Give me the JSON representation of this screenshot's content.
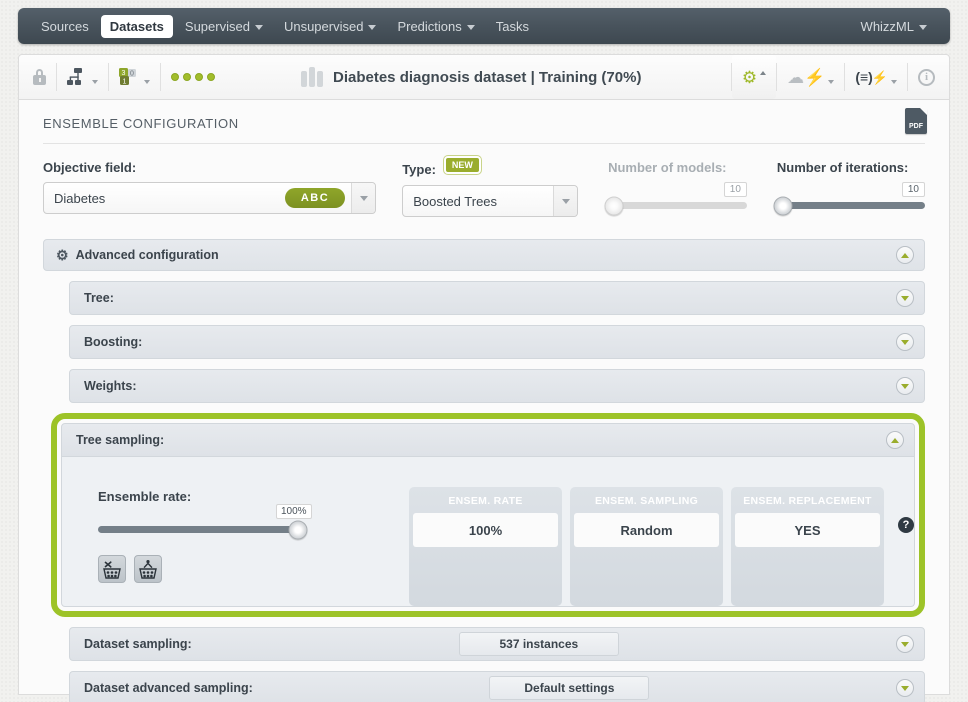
{
  "nav": {
    "items": [
      {
        "label": "Sources",
        "caret": false,
        "active": false
      },
      {
        "label": "Datasets",
        "caret": false,
        "active": true
      },
      {
        "label": "Supervised",
        "caret": true,
        "active": false
      },
      {
        "label": "Unsupervised",
        "caret": true,
        "active": false
      },
      {
        "label": "Predictions",
        "caret": true,
        "active": false
      },
      {
        "label": "Tasks",
        "caret": false,
        "active": false
      }
    ],
    "right": {
      "label": "WhizzML",
      "caret": true
    }
  },
  "toolbar": {
    "lock_icon": "lock-icon",
    "tree_icon": "model-tree-icon",
    "numeric_icon": "field-types-icon",
    "status_dots": 4,
    "dataset_icon": "dataset-bars-icon",
    "title": "Diabetes diagnosis dataset | Training (70%)",
    "right_icons": [
      {
        "name": "configure-gear-icon",
        "glyph": "⚙",
        "state": "active"
      },
      {
        "name": "flash-cloud-icon",
        "glyph": "⚡",
        "state": "disabled"
      },
      {
        "name": "batch-script-icon",
        "glyph": "(≡)",
        "state": "active"
      },
      {
        "name": "info-icon",
        "glyph": "i",
        "state": "disabled"
      }
    ]
  },
  "panel": {
    "title": "ENSEMBLE CONFIGURATION",
    "pdf_label": "PDF"
  },
  "form": {
    "objective": {
      "label": "Objective field:",
      "value": "Diabetes",
      "badge": "ABC"
    },
    "type": {
      "label": "Type:",
      "badge": "NEW",
      "value": "Boosted Trees"
    },
    "number_of_models": {
      "label": "Number of models:",
      "value": "10",
      "percent": 4,
      "disabled": true
    },
    "number_of_iterations": {
      "label": "Number of iterations:",
      "value": "10",
      "percent": 4,
      "disabled": false
    }
  },
  "advanced": {
    "label": "Advanced configuration",
    "expanded": true,
    "sections": [
      {
        "label": "Tree:",
        "expanded": false,
        "pill": ""
      },
      {
        "label": "Boosting:",
        "expanded": false,
        "pill": ""
      },
      {
        "label": "Weights:",
        "expanded": false,
        "pill": ""
      }
    ],
    "bottom_sections": [
      {
        "label": "Dataset sampling:",
        "expanded": false,
        "pill": "537 instances"
      },
      {
        "label": "Dataset advanced sampling:",
        "expanded": false,
        "pill": "Default settings"
      }
    ]
  },
  "tree_sampling": {
    "label": "Tree sampling:",
    "expanded": true,
    "highlight_color": "#9dc328",
    "ensemble_rate": {
      "label": "Ensemble rate:",
      "value": "100%",
      "percent": 100
    },
    "sampling_buttons": [
      {
        "name": "random-sampling-icon"
      },
      {
        "name": "deterministic-sampling-icon"
      }
    ],
    "stats": [
      {
        "header": "ENSEM. RATE",
        "value": "100%"
      },
      {
        "header": "ENSEM. SAMPLING",
        "value": "Random"
      },
      {
        "header": "ENSEM. REPLACEMENT",
        "value": "YES"
      }
    ],
    "help_icon": "?"
  },
  "colors": {
    "accent_green": "#9aad2d",
    "highlight_green": "#9dc328",
    "navbar_dark": "#48535c",
    "text_dark": "#3b444c"
  }
}
